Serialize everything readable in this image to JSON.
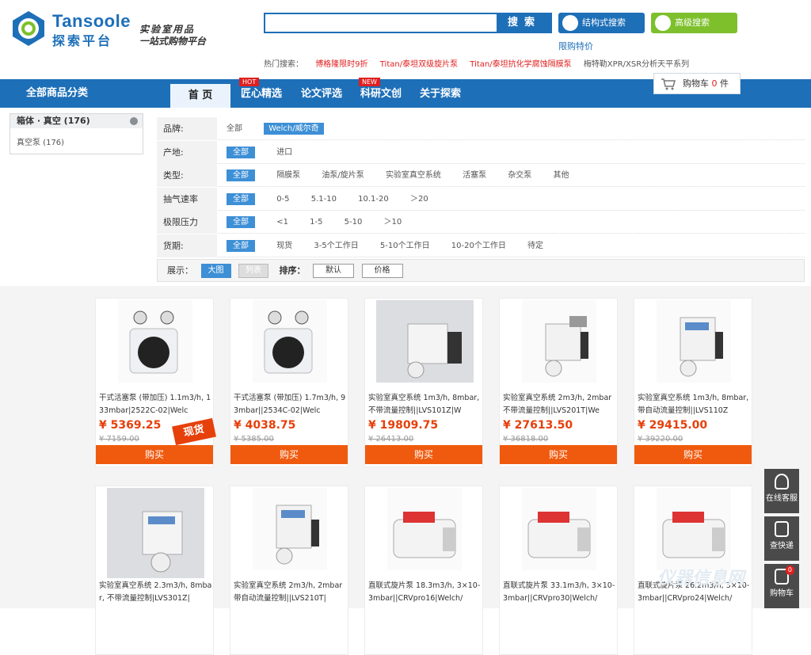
{
  "logo": {
    "en": "Tansoole",
    "cn": "探索平台"
  },
  "slogan": {
    "line1": "实验室用品",
    "line2": "一站式购物平台"
  },
  "search": {
    "placeholder": "",
    "button": "搜索"
  },
  "struct_search": "结构式搜索",
  "adv_search": "高级搜索",
  "promo_link": "限购特价",
  "hot_search": {
    "label": "热门搜索：",
    "items": [
      "博格隆限时9折",
      "Titan/泰坦双级旋片泵",
      "Titan/泰坦抗化学腐蚀隔膜泵",
      "梅特勒XPR/XSR分析天平系列"
    ]
  },
  "nav": {
    "all_categories": "全部商品分类",
    "items": [
      {
        "label": "首 页",
        "badge": ""
      },
      {
        "label": "匠心精选",
        "badge": "HOT"
      },
      {
        "label": "论文评选",
        "badge": ""
      },
      {
        "label": "科研文创",
        "badge": "NEW"
      },
      {
        "label": "关于探索",
        "badge": ""
      }
    ]
  },
  "cart": {
    "label": "购物车",
    "count": "0",
    "unit": "件"
  },
  "sidebar": {
    "heading": "箱体 · 真空 (176)",
    "item": "真空泵 (176)"
  },
  "filters": [
    {
      "label": "品牌:",
      "options": [
        "全部",
        "Welch/威尔奇"
      ]
    },
    {
      "label": "产地:",
      "options": [
        "全部",
        "进口"
      ]
    },
    {
      "label": "类型:",
      "options": [
        "全部",
        "隔膜泵",
        "油泵/旋片泵",
        "实验室真空系统",
        "活塞泵",
        "杂交泵",
        "其他"
      ]
    },
    {
      "label": "抽气速率",
      "options": [
        "全部",
        "0-5",
        "5.1-10",
        "10.1-20",
        "＞20"
      ]
    },
    {
      "label": "极限压力",
      "options": [
        "全部",
        "<1",
        "1-5",
        "5-10",
        "＞10"
      ]
    },
    {
      "label": "货期:",
      "options": [
        "全部",
        "现货",
        "3-5个工作日",
        "5-10个工作日",
        "10-20个工作日",
        "待定"
      ]
    }
  ],
  "sortbar": {
    "display_label": "展示：",
    "large": "大图",
    "list": "列表",
    "sort_label": "排序：",
    "default": "默认",
    "price": "价格"
  },
  "products": [
    {
      "name": "干式活塞泵 (带加压) 1.1m3/h, 133mbar|2522C-02|Welc",
      "price": "¥ 5369.25",
      "old": "¥ 7159.00",
      "badge": "现货"
    },
    {
      "name": "干式活塞泵 (带加压) 1.7m3/h, 93mbar||2534C-02|Welc",
      "price": "¥ 4038.75",
      "old": "¥ 5385.00",
      "badge": ""
    },
    {
      "name": "实验室真空系统 1m3/h, 8mbar, 不带流量控制||LVS101Z|W",
      "price": "¥ 19809.75",
      "old": "¥ 26413.00",
      "badge": ""
    },
    {
      "name": "实验室真空系统 2m3/h, 2mbar 不带流量控制||LVS201T|We",
      "price": "¥ 27613.50",
      "old": "¥ 36818.00",
      "badge": ""
    },
    {
      "name": "实验室真空系统 1m3/h, 8mbar, 带自动流量控制||LVS110Z",
      "price": "¥ 29415.00",
      "old": "¥ 39220.00",
      "badge": ""
    },
    {
      "name": "实验室真空系统 2.3m3/h, 8mbar, 不带流量控制|LVS301Z|",
      "price": "",
      "old": "",
      "badge": ""
    },
    {
      "name": "实验室真空系统 2m3/h, 2mbar 带自动流量控制||LVS210T|",
      "price": "",
      "old": "",
      "badge": ""
    },
    {
      "name": "直联式旋片泵 18.3m3/h, 3×10-3mbar||CRVpro16|Welch/",
      "price": "",
      "old": "",
      "badge": ""
    },
    {
      "name": "直联式旋片泵 33.1m3/h, 3×10-3mbar||CRVpro30|Welch/",
      "price": "",
      "old": "",
      "badge": ""
    },
    {
      "name": "直联式旋片泵 26.2m3/h, 3×10-3mbar||CRVpro24|Welch/",
      "price": "",
      "old": "",
      "badge": ""
    }
  ],
  "buy_label": "购买",
  "side_tools": [
    {
      "label": "在线客服"
    },
    {
      "label": "查快递"
    },
    {
      "label": "购物车",
      "count": "0"
    }
  ],
  "watermark": "仪器信息网",
  "colors": {
    "brand_blue": "#1d6fb8",
    "accent_green": "#7dc02c",
    "price_red": "#e6400b",
    "buy_orange": "#f05a0e"
  }
}
